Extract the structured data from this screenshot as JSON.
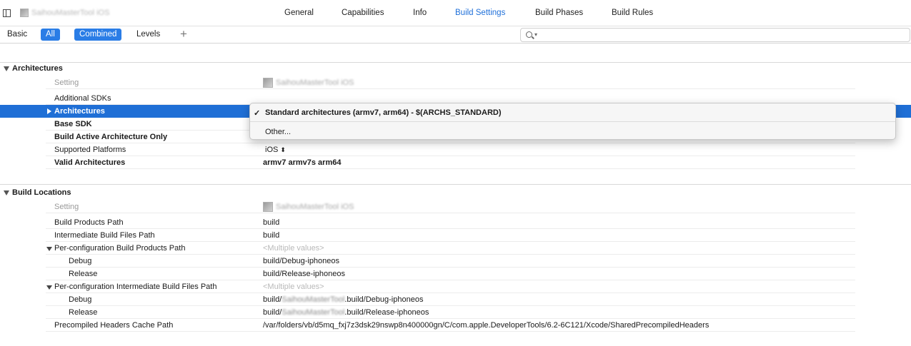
{
  "header": {
    "target_name": "SaihouMasterTool iOS",
    "tabs": [
      "General",
      "Capabilities",
      "Info",
      "Build Settings",
      "Build Phases",
      "Build Rules"
    ],
    "active_tab": "Build Settings"
  },
  "filter_bar": {
    "basic": "Basic",
    "all": "All",
    "combined": "Combined",
    "levels": "Levels",
    "add": "+",
    "search_placeholder": ""
  },
  "architectures": {
    "title": "Architectures",
    "setting_header": "Setting",
    "target_name": "SaihouMasterTool iOS",
    "rows": [
      {
        "label": "Additional SDKs",
        "value": ""
      },
      {
        "label": "Architectures",
        "value": ""
      },
      {
        "label": "Base SDK",
        "value": ""
      },
      {
        "label": "Build Active Architecture Only",
        "value": ""
      },
      {
        "label": "Supported Platforms",
        "value": "iOS"
      },
      {
        "label": "Valid Architectures",
        "value": "armv7 armv7s arm64"
      }
    ]
  },
  "popup": {
    "checkmark": "✓",
    "selected": "Standard architectures (armv7, arm64)  -  $(ARCHS_STANDARD)",
    "other": "Other..."
  },
  "build_locations": {
    "title": "Build Locations",
    "setting_header": "Setting",
    "target_name": "SaihouMasterTool iOS",
    "project_name": "SaihouMasterTool",
    "rows": [
      {
        "label": "Build Products Path",
        "value": "build"
      },
      {
        "label": "Intermediate Build Files Path",
        "value": "build"
      },
      {
        "label": "Per-configuration Build Products Path",
        "value": "<Multiple values>"
      },
      {
        "label": "Debug",
        "value": "build/Debug-iphoneos"
      },
      {
        "label": "Release",
        "value": "build/Release-iphoneos"
      },
      {
        "label": "Per-configuration Intermediate Build Files Path",
        "value": "<Multiple values>"
      },
      {
        "label": "Debug",
        "value_prefix": "build/",
        "value_suffix": ".build/Debug-iphoneos"
      },
      {
        "label": "Release",
        "value_prefix": "build/",
        "value_suffix": ".build/Release-iphoneos"
      },
      {
        "label": "Precompiled Headers Cache Path",
        "value": "/var/folders/vb/d5mq_fxj7z3dsk29nswp8n400000gn/C/com.apple.DeveloperTools/6.2-6C121/Xcode/SharedPrecompiledHeaders"
      }
    ]
  }
}
